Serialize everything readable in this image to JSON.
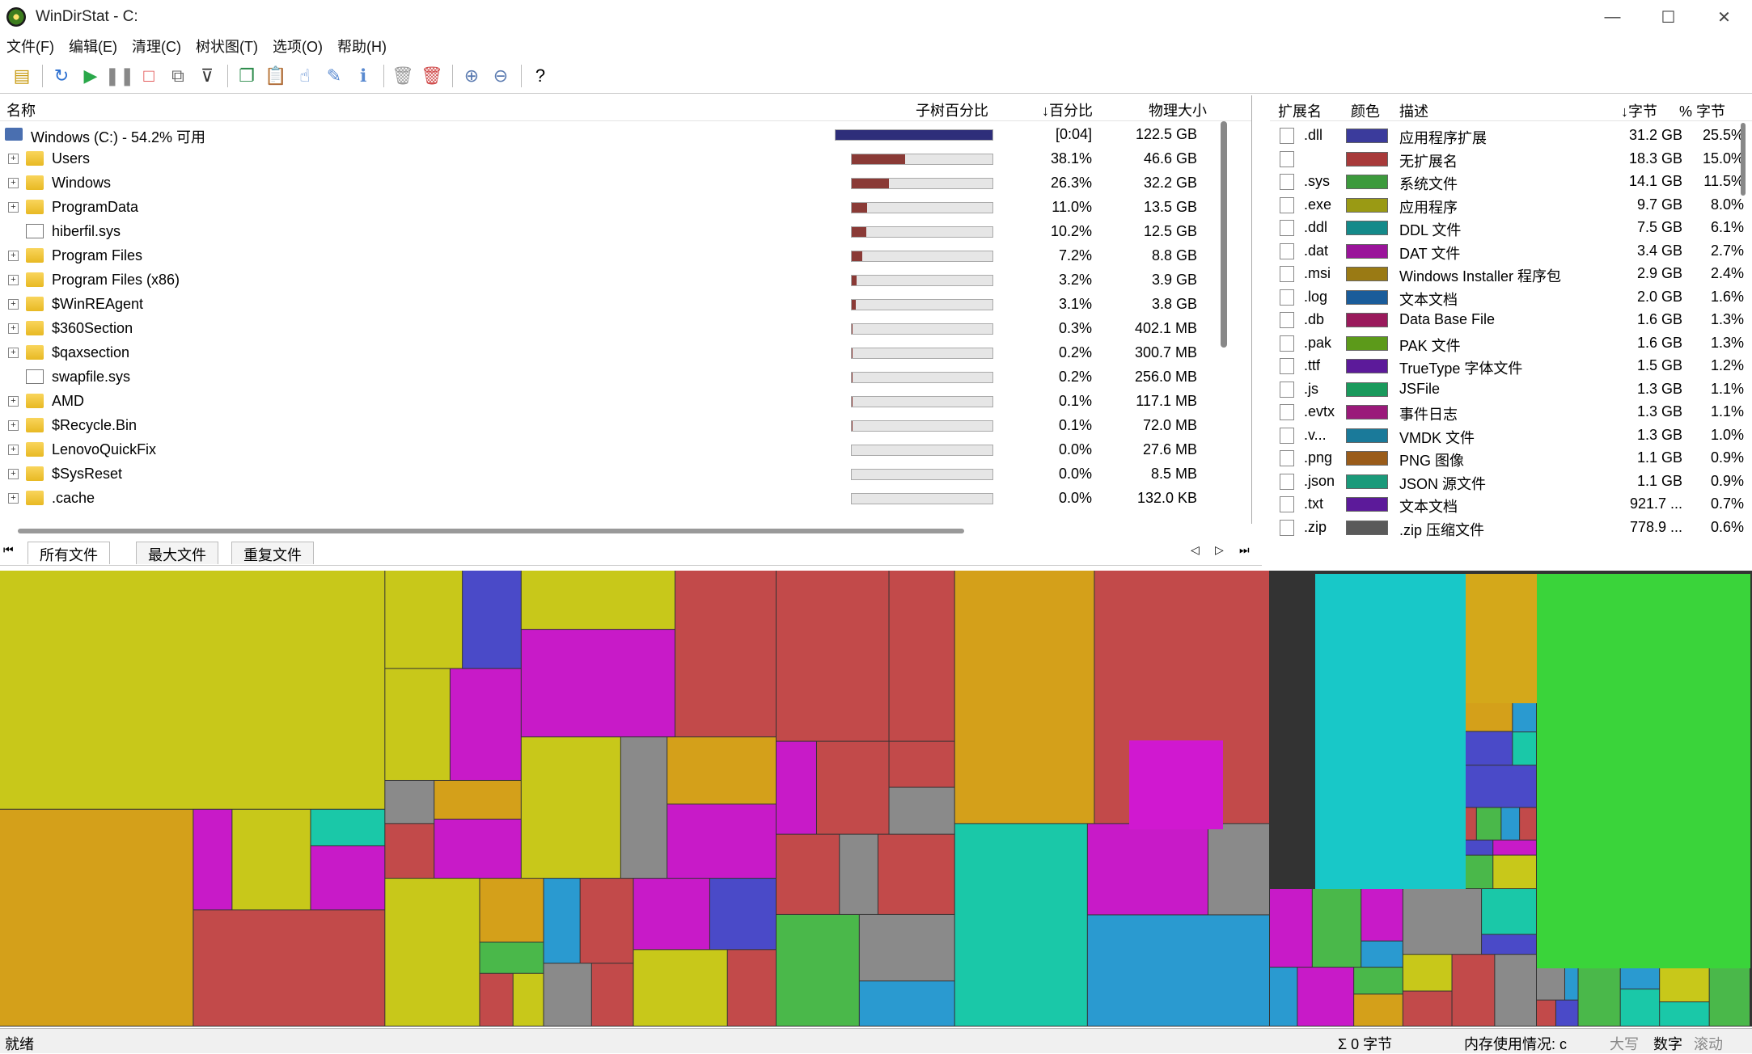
{
  "window": {
    "title": "WinDirStat - C:",
    "minimize": "—",
    "maximize": "☐",
    "close": "✕"
  },
  "menu": [
    "文件(F)",
    "编辑(E)",
    "清理(C)",
    "树状图(T)",
    "选项(O)",
    "帮助(H)"
  ],
  "toolbar": {
    "help": "?"
  },
  "tree": {
    "headers": {
      "name": "名称",
      "subtree": "子树百分比",
      "percent": "↓百分比",
      "size": "物理大小"
    },
    "root": {
      "name": "Windows (C:) - 54.2% 可用",
      "percent": "[0:04]",
      "size": "122.5 GB",
      "fill": 1.0
    },
    "rows": [
      {
        "name": "Users",
        "percent": "38.1%",
        "size": "46.6 GB",
        "fill": 0.381,
        "type": "folder"
      },
      {
        "name": "Windows",
        "percent": "26.3%",
        "size": "32.2 GB",
        "fill": 0.263,
        "type": "folder"
      },
      {
        "name": "ProgramData",
        "percent": "11.0%",
        "size": "13.5 GB",
        "fill": 0.11,
        "type": "folder"
      },
      {
        "name": "hiberfil.sys",
        "percent": "10.2%",
        "size": "12.5 GB",
        "fill": 0.102,
        "type": "file"
      },
      {
        "name": "Program Files",
        "percent": "7.2%",
        "size": "8.8 GB",
        "fill": 0.072,
        "type": "folder"
      },
      {
        "name": "Program Files (x86)",
        "percent": "3.2%",
        "size": "3.9 GB",
        "fill": 0.032,
        "type": "folder"
      },
      {
        "name": "$WinREAgent",
        "percent": "3.1%",
        "size": "3.8 GB",
        "fill": 0.031,
        "type": "folder"
      },
      {
        "name": "$360Section",
        "percent": "0.3%",
        "size": "402.1 MB",
        "fill": 0.003,
        "type": "folder"
      },
      {
        "name": "$qaxsection",
        "percent": "0.2%",
        "size": "300.7 MB",
        "fill": 0.002,
        "type": "folder"
      },
      {
        "name": "swapfile.sys",
        "percent": "0.2%",
        "size": "256.0 MB",
        "fill": 0.002,
        "type": "file"
      },
      {
        "name": "AMD",
        "percent": "0.1%",
        "size": "117.1 MB",
        "fill": 0.001,
        "type": "folder"
      },
      {
        "name": "$Recycle.Bin",
        "percent": "0.1%",
        "size": "72.0 MB",
        "fill": 0.001,
        "type": "folder"
      },
      {
        "name": "LenovoQuickFix",
        "percent": "0.0%",
        "size": "27.6 MB",
        "fill": 0,
        "type": "folder"
      },
      {
        "name": "$SysReset",
        "percent": "0.0%",
        "size": "8.5 MB",
        "fill": 0,
        "type": "folder"
      },
      {
        "name": ".cache",
        "percent": "0.0%",
        "size": "132.0 KB",
        "fill": 0,
        "type": "folder"
      }
    ]
  },
  "ext": {
    "headers": {
      "ext": "扩展名",
      "color": "颜色",
      "desc": "描述",
      "bytes": "↓字节",
      "pct": "% 字节"
    },
    "rows": [
      {
        "ext": ".dll",
        "color": "#3b3b9c",
        "desc": "应用程序扩展",
        "bytes": "31.2 GB",
        "pct": "25.5%"
      },
      {
        "ext": "",
        "color": "#a83a3a",
        "desc": "无扩展名",
        "bytes": "18.3 GB",
        "pct": "15.0%"
      },
      {
        "ext": ".sys",
        "color": "#3c9a3c",
        "desc": "系统文件",
        "bytes": "14.1 GB",
        "pct": "11.5%"
      },
      {
        "ext": ".exe",
        "color": "#9a9a14",
        "desc": "应用程序",
        "bytes": "9.7 GB",
        "pct": "8.0%"
      },
      {
        "ext": ".ddl",
        "color": "#148a8a",
        "desc": "DDL 文件",
        "bytes": "7.5 GB",
        "pct": "6.1%"
      },
      {
        "ext": ".dat",
        "color": "#9a149a",
        "desc": "DAT 文件",
        "bytes": "3.4 GB",
        "pct": "2.7%"
      },
      {
        "ext": ".msi",
        "color": "#9a7a14",
        "desc": "Windows Installer 程序包",
        "bytes": "2.9 GB",
        "pct": "2.4%"
      },
      {
        "ext": ".log",
        "color": "#1a5c9a",
        "desc": "文本文档",
        "bytes": "2.0 GB",
        "pct": "1.6%"
      },
      {
        "ext": ".db",
        "color": "#9a1a5c",
        "desc": "Data Base File",
        "bytes": "1.6 GB",
        "pct": "1.3%"
      },
      {
        "ext": ".pak",
        "color": "#5c9a1a",
        "desc": "PAK 文件",
        "bytes": "1.6 GB",
        "pct": "1.3%"
      },
      {
        "ext": ".ttf",
        "color": "#5c1a9a",
        "desc": "TrueType 字体文件",
        "bytes": "1.5 GB",
        "pct": "1.2%"
      },
      {
        "ext": ".js",
        "color": "#1a9a5c",
        "desc": "JSFile",
        "bytes": "1.3 GB",
        "pct": "1.1%"
      },
      {
        "ext": ".evtx",
        "color": "#9a1a7a",
        "desc": "事件日志",
        "bytes": "1.3 GB",
        "pct": "1.1%"
      },
      {
        "ext": ".v...",
        "color": "#1a7a9a",
        "desc": "VMDK 文件",
        "bytes": "1.3 GB",
        "pct": "1.0%"
      },
      {
        "ext": ".png",
        "color": "#9a5c1a",
        "desc": "PNG 图像",
        "bytes": "1.1 GB",
        "pct": "0.9%"
      },
      {
        "ext": ".json",
        "color": "#1a9a7a",
        "desc": "JSON 源文件",
        "bytes": "1.1 GB",
        "pct": "0.9%"
      },
      {
        "ext": ".txt",
        "color": "#5c1a9a",
        "desc": "文本文档",
        "bytes": "921.7 ...",
        "pct": "0.7%"
      },
      {
        "ext": ".zip",
        "color": "#5a5a5a",
        "desc": ".zip 压缩文件",
        "bytes": "778.9 ...",
        "pct": "0.6%"
      }
    ]
  },
  "tabs": [
    "所有文件",
    "最大文件",
    "重复文件"
  ],
  "status": {
    "ready": "就绪",
    "sum": "Σ 0 字节",
    "mem": "内存使用情况: c",
    "caps": "大写",
    "num": "数字",
    "scroll": "滚动"
  }
}
